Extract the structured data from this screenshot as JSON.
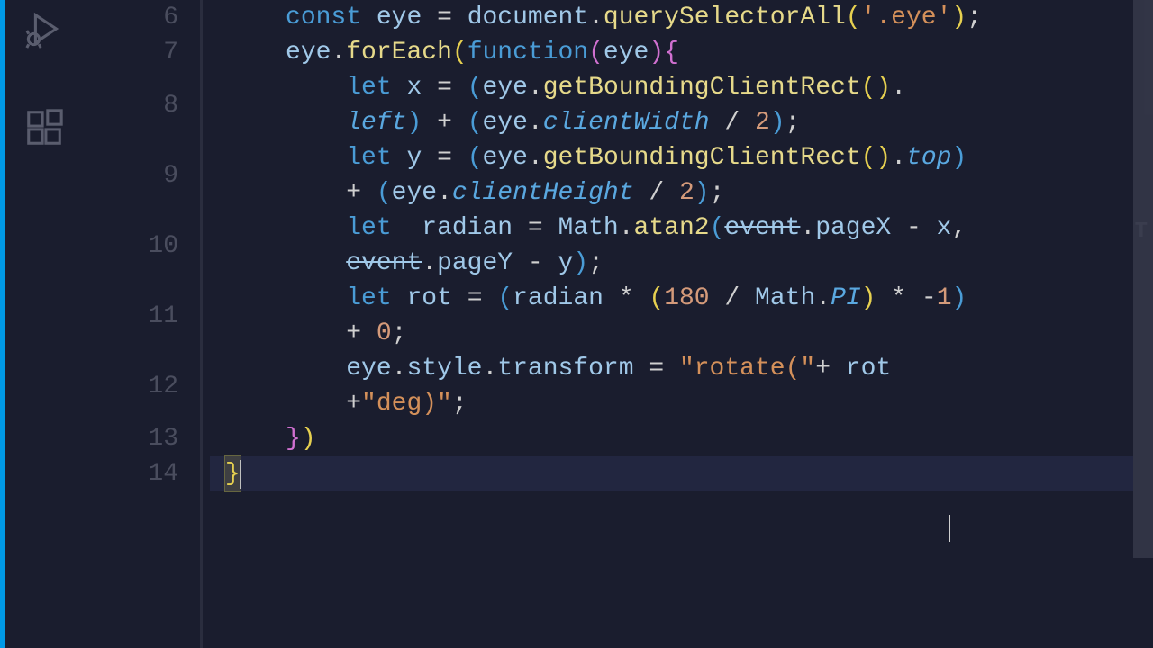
{
  "activity": {
    "debug": "run-debug-icon",
    "extensions": "extensions-icon"
  },
  "lineNumbers": [
    "6",
    "7",
    "8",
    "9",
    "10",
    "11",
    "12",
    "13",
    "14"
  ],
  "code": {
    "l6": {
      "const": "const",
      "eye": "eye",
      "eq": " = ",
      "doc": "document",
      "dot1": ".",
      "qsa": "querySelectorAll",
      "lp": "(",
      "str": "'.eye'",
      "rp": ")",
      "semi": ";"
    },
    "l7": {
      "eye": "eye",
      "dot": ".",
      "foreach": "forEach",
      "lp": "(",
      "fn": "function",
      "lp2": "(",
      "param": "eye",
      "rp2": ")",
      "lb": "{"
    },
    "l8a": {
      "let": "let",
      "x": "x",
      "eq": " = ",
      "lp": "(",
      "eye": "eye",
      "dot": ".",
      "gbc": "getBoundingClientRect",
      "lp2": "(",
      "rp2": ")",
      "dot2": "."
    },
    "l8b": {
      "left": "left",
      "rp": ")",
      "plus": " + ",
      "lp2": "(",
      "eye": "eye",
      "dot": ".",
      "cw": "clientWidth",
      "div": " / ",
      "two": "2",
      "rp2": ")",
      "semi": ";"
    },
    "l9a": {
      "let": "let",
      "y": "y",
      "eq": " = ",
      "lp": "(",
      "eye": "eye",
      "dot": ".",
      "gbc": "getBoundingClientRect",
      "lp2": "(",
      "rp2": ")",
      "dot2": ".",
      "top": "top",
      "rp3": ")"
    },
    "l9b": {
      "plus": "+ ",
      "lp": "(",
      "eye": "eye",
      "dot": ".",
      "ch": "clientHeight",
      "div": " / ",
      "two": "2",
      "rp": ")",
      "semi": ";"
    },
    "l10a": {
      "let": "let",
      "sp": "  ",
      "radian": "radian",
      "eq": " = ",
      "math": "Math",
      "dot": ".",
      "atan2": "atan2",
      "lp": "(",
      "event": "event",
      "dot2": ".",
      "pageX": "pageX",
      "minus": " - ",
      "x": "x",
      "comma": ","
    },
    "l10b": {
      "event": "event",
      "dot": ".",
      "pageY": "pageY",
      "minus": " - ",
      "y": "y",
      "rp": ")",
      "semi": ";"
    },
    "l11a": {
      "let": "let",
      "rot": "rot",
      "eq": " = ",
      "lp": "(",
      "radian": "radian",
      "mul": " * ",
      "lp2": "(",
      "n180": "180",
      "div": " / ",
      "math": "Math",
      "dot": ".",
      "pi": "PI",
      "rp2": ")",
      "mul2": " * ",
      "neg": "-",
      "one": "1",
      "rp3": ")"
    },
    "l11b": {
      "plus": "+ ",
      "zero": "0",
      "semi": ";"
    },
    "l12a": {
      "eye": "eye",
      "dot": ".",
      "style": "style",
      "dot2": ".",
      "transform": "transform",
      "eq": " = ",
      "str1": "\"rotate(\"",
      "plus": "+ ",
      "rot": "rot"
    },
    "l12b": {
      "plus": "+",
      "str2": "\"deg)\"",
      "semi": ";"
    },
    "l13": {
      "rb": "}",
      "rp": ")"
    },
    "l14": {
      "rb": "}"
    }
  }
}
